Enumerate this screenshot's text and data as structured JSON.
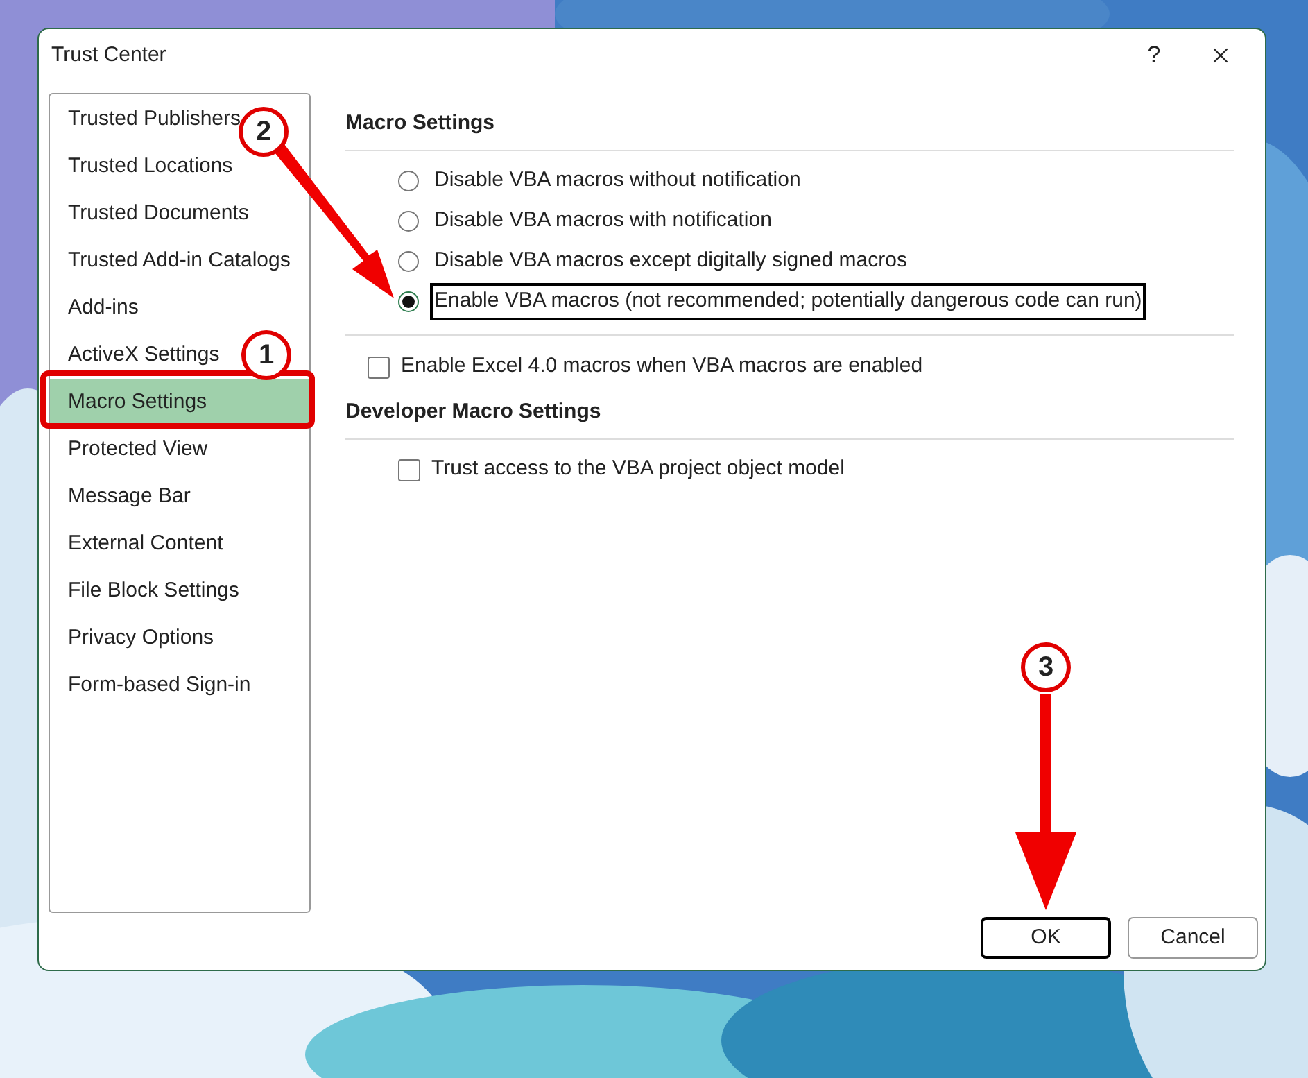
{
  "window": {
    "title": "Trust Center",
    "help": "?"
  },
  "sidebar": {
    "items": [
      {
        "label": "Trusted Publishers",
        "selected": false
      },
      {
        "label": "Trusted Locations",
        "selected": false
      },
      {
        "label": "Trusted Documents",
        "selected": false
      },
      {
        "label": "Trusted Add-in Catalogs",
        "selected": false
      },
      {
        "label": "Add-ins",
        "selected": false
      },
      {
        "label": "ActiveX Settings",
        "selected": false
      },
      {
        "label": "Macro Settings",
        "selected": true
      },
      {
        "label": "Protected View",
        "selected": false
      },
      {
        "label": "Message Bar",
        "selected": false
      },
      {
        "label": "External Content",
        "selected": false
      },
      {
        "label": "File Block Settings",
        "selected": false
      },
      {
        "label": "Privacy Options",
        "selected": false
      },
      {
        "label": "Form-based Sign-in",
        "selected": false
      }
    ]
  },
  "sections": [
    {
      "heading": "Macro Settings",
      "groups": [
        [
          {
            "kind": "radio",
            "label": "Disable VBA macros without notification",
            "selected": false,
            "focused": false
          },
          {
            "kind": "radio",
            "label": "Disable VBA macros with notification",
            "selected": false,
            "focused": false
          },
          {
            "kind": "radio",
            "label": "Disable VBA macros except digitally signed macros",
            "selected": false,
            "focused": false
          },
          {
            "kind": "radio",
            "label": "Enable VBA macros (not recommended; potentially dangerous code can run)",
            "selected": true,
            "focused": true
          }
        ],
        [
          {
            "kind": "checkbox",
            "label": "Enable Excel 4.0 macros when VBA macros are enabled",
            "checked": false
          }
        ]
      ]
    },
    {
      "heading": "Developer Macro Settings",
      "groups": [
        [
          {
            "kind": "checkbox",
            "label": "Trust access to the VBA project object model",
            "checked": false
          }
        ]
      ]
    }
  ],
  "buttons": [
    {
      "label": "OK",
      "default": true
    },
    {
      "label": "Cancel",
      "default": false
    }
  ],
  "annotations": [
    {
      "number": "1",
      "outline": true,
      "arrow": false
    },
    {
      "number": "2",
      "outline": false,
      "arrow": true
    },
    {
      "number": "3",
      "outline": false,
      "arrow": true
    }
  ]
}
